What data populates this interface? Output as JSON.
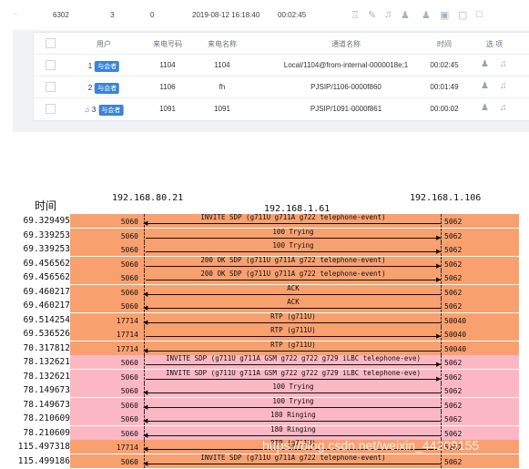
{
  "top_row": {
    "number": "6302",
    "members": "3",
    "zero": "0",
    "start_time": "2019-08-12 16:18:40",
    "duration": "00:02:45"
  },
  "table": {
    "headers": [
      "用户",
      "来电号码",
      "来电名称",
      "通道名称",
      "时间",
      "选 项"
    ],
    "rows": [
      {
        "index": "1",
        "badge": "与会者",
        "caller_id": "1104",
        "caller_name": "1104",
        "channel": "Local/1104@from-internal-0000018e;1",
        "time": "00:02:45"
      },
      {
        "index": "2",
        "badge": "与会者",
        "caller_id": "1106",
        "caller_name": "fh",
        "channel": "PJSIP/1106-0000f860",
        "time": "00:01:49"
      },
      {
        "index": "3",
        "badge": "与会者",
        "caller_id": "1091",
        "caller_name": "1091",
        "channel": "PJSIP/1091-0000f861",
        "time": "00:00:02"
      }
    ]
  },
  "ladder": {
    "time_header": "时间",
    "host_left": "192.168.80.21",
    "host_mid": "192.168.1.61",
    "host_right": "192.168.1.106",
    "rows": [
      {
        "t": "69.329495",
        "lp": "5060",
        "rp": "5062",
        "msg": "INVITE SDP (g711U g711A g722 telephone-event)",
        "dir": "left",
        "color": "orange"
      },
      {
        "t": "69.339253",
        "lp": "5060",
        "rp": "5062",
        "msg": "100 Trying",
        "dir": "right",
        "color": "orange"
      },
      {
        "t": "69.339253",
        "lp": "5060",
        "rp": "5062",
        "msg": "100 Trying",
        "dir": "right",
        "color": "orange"
      },
      {
        "t": "69.456562",
        "lp": "5060",
        "rp": "5062",
        "msg": "200 OK SDP (g711U g711A g722 telephone-event)",
        "dir": "right",
        "color": "orange"
      },
      {
        "t": "69.456562",
        "lp": "5060",
        "rp": "5062",
        "msg": "200 OK SDP (g711U g711A g722 telephone-event)",
        "dir": "right",
        "color": "orange"
      },
      {
        "t": "69.460217",
        "lp": "5060",
        "rp": "5062",
        "msg": "ACK",
        "dir": "left",
        "color": "orange"
      },
      {
        "t": "69.460217",
        "lp": "5060",
        "rp": "5062",
        "msg": "ACK",
        "dir": "left",
        "color": "orange"
      },
      {
        "t": "69.514254",
        "lp": "17714",
        "rp": "50040",
        "msg": "RTP (g711U)",
        "dir": "left",
        "color": "orange"
      },
      {
        "t": "69.536526",
        "lp": "17714",
        "rp": "50040",
        "msg": "RTP (g711U)",
        "dir": "right",
        "color": "orange"
      },
      {
        "t": "70.317812",
        "lp": "17714",
        "rp": "50040",
        "msg": "RTP (g711U)",
        "dir": "left",
        "color": "orange"
      },
      {
        "t": "78.132621",
        "lp": "5060",
        "rp": "5062",
        "msg": "INVITE SDP (g711U g711A GSM g722 g722 g729 iLBC telephone-eve)",
        "dir": "right",
        "color": "pink"
      },
      {
        "t": "78.132621",
        "lp": "5060",
        "rp": "5062",
        "msg": "INVITE SDP (g711U g711A GSM g722 g722 g729 iLBC telephone-eve)",
        "dir": "right",
        "color": "pink"
      },
      {
        "t": "78.149673",
        "lp": "5060",
        "rp": "5062",
        "msg": "100 Trying",
        "dir": "left",
        "color": "pink"
      },
      {
        "t": "78.149673",
        "lp": "5060",
        "rp": "5062",
        "msg": "100 Trying",
        "dir": "left",
        "color": "pink"
      },
      {
        "t": "78.210609",
        "lp": "5060",
        "rp": "5062",
        "msg": "180 Ringing",
        "dir": "left",
        "color": "pink"
      },
      {
        "t": "78.210609",
        "lp": "5060",
        "rp": "5062",
        "msg": "180 Ringing",
        "dir": "left",
        "color": "pink"
      },
      {
        "t": "115.497318",
        "lp": "17714",
        "rp": "5062",
        "msg": "RTP (g711U)",
        "dir": "left",
        "color": "orange"
      },
      {
        "t": "115.499186",
        "lp": "5060",
        "rp": "5062",
        "msg": "INVITE SDP (g711U g711A g722 telephone-event)",
        "dir": "left",
        "color": "orange"
      }
    ]
  },
  "watermark": "https://blog.csdn.net/weixin_44209155",
  "colors": {
    "orange": "#f9a06f",
    "pink": "#fbb8c4",
    "badge": "#3a83d8"
  }
}
